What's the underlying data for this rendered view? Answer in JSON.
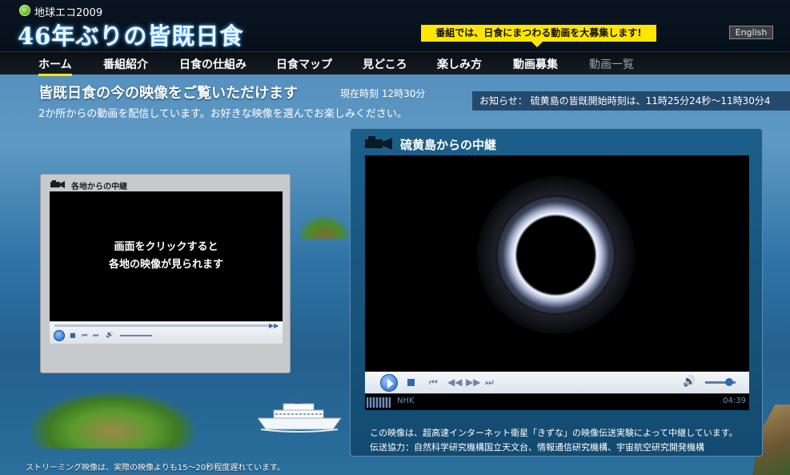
{
  "header": {
    "logo_small": "地球エコ2009",
    "title": "46年ぶりの皆既日食",
    "banner": "番組では、日食にまつわる動画を大募集します!",
    "english_label": "English"
  },
  "nav": {
    "items": [
      {
        "label": "ホーム",
        "active": true
      },
      {
        "label": "番組紹介"
      },
      {
        "label": "日食の仕組み"
      },
      {
        "label": "日食マップ"
      },
      {
        "label": "見どころ"
      },
      {
        "label": "楽しみ方"
      },
      {
        "label": "動画募集"
      },
      {
        "label": "動画一覧",
        "dim": true
      }
    ]
  },
  "main": {
    "headline": "皆既日食の今の映像をご覧いただけます",
    "current_time": "現在時刻 12時30分",
    "subline": "2か所からの動画を配信しています。お好きな映像を選んでお楽しみください。",
    "notice": "お知らせ： 硫黄島の皆既開始時刻は、11時25分24秒〜11時30分4"
  },
  "small_player": {
    "title": "各地からの中継",
    "screen_line1": "画面をクリックすると",
    "screen_line2": "各地の映像が見られます"
  },
  "big_player": {
    "title": "硫黄島からの中継",
    "status_label": "NHK",
    "elapsed": "04:39",
    "desc_line1": "この映像は、超高速インターネット衛星「きずな」の映像伝送実験によって中継しています。",
    "desc_line2": "伝送協力：自然科学研究機構国立天文台、情報通信研究機構、宇宙航空研究開発機構"
  },
  "footer": {
    "note": "ストリーミング映像は、実際の映像よりも15〜20秒程度遅れています。"
  },
  "colors": {
    "banner": "#ffe600",
    "nav_active_underline": "#ffe600",
    "panel_blue": "#1c5f8a"
  }
}
